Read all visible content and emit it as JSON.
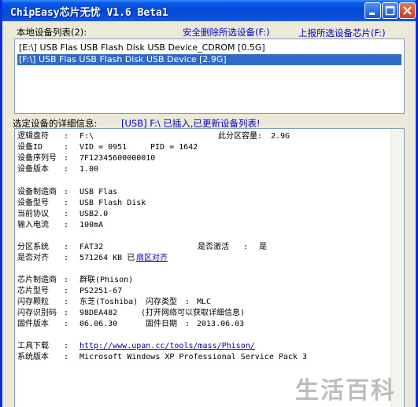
{
  "window": {
    "title": "ChipEasy芯片无忧 V1.6 Beta1"
  },
  "device_list": {
    "label": "本地设备列表(2):",
    "safe_remove_link": "安全删除所选设备(F:)",
    "report_link": "上报所选设备芯片(F:)",
    "items": [
      {
        "text": "[E:\\] USB Flas USB Flash Disk USB Device_CDROM [0.5G]",
        "selected": false
      },
      {
        "text": "[F:\\] USB Flas USB Flash Disk USB Device [2.9G]",
        "selected": true
      }
    ]
  },
  "details": {
    "label": "选定设备的详细信息:",
    "status": "[USB] F:\\ 已插入,已更新设备列表!",
    "logical_drive_label": "逻辑盘符",
    "logical_drive_value": "F:\\",
    "partition_capacity_label": "此分区容量:",
    "partition_capacity_value": "2.9G",
    "device_id_label": "设备ID",
    "vid_label": "VID = 0951",
    "pid_label": "PID = 1642",
    "serial_label": "设备序列号",
    "serial_value": "7F12345600000010",
    "version_label": "设备版本",
    "version_value": "1.00",
    "manufacturer_label": "设备制造商",
    "manufacturer_value": "USB Flas",
    "model_label": "设备型号",
    "model_value": "USB Flash Disk",
    "protocol_label": "当前协议",
    "protocol_value": "USB2.0",
    "current_label": "输入电流",
    "current_value": "100mA",
    "fs_label": "分区系统",
    "fs_value": "FAT32",
    "active_label": "是否激活",
    "active_value": "是",
    "aligned_label": "是否对齐",
    "aligned_value": "571264 KB 已",
    "aligned_link": "扇区对齐",
    "chip_maker_label": "芯片制造商",
    "chip_maker_value": "群联(Phison)",
    "chip_model_label": "芯片型号",
    "chip_model_value": "PS2251-67",
    "flash_label": "闪存颗粒",
    "flash_value": "东芝(Toshiba)",
    "flash_type_label": "闪存类型",
    "flash_type_value": "MLC",
    "flash_id_label": "闪存识别码",
    "flash_id_value": "98DEA482",
    "flash_id_note": "(打开网络可以获取详细信息)",
    "firmware_label": "固件版本",
    "firmware_value": "06.06.30",
    "firmware_date_label": "固件日期",
    "firmware_date_value": "2013.06.03",
    "tool_label": "工具下载",
    "tool_link": "http://www.upan.cc/tools/mass/Phison/",
    "os_label": "系统版本",
    "os_value": "Microsoft Windows XP Professional Service Pack 3",
    "sep": ":"
  },
  "watermark": "生活百科",
  "colors": {
    "titlebar": "#0548d6",
    "selection": "#316ac5",
    "link": "#0000cc"
  }
}
